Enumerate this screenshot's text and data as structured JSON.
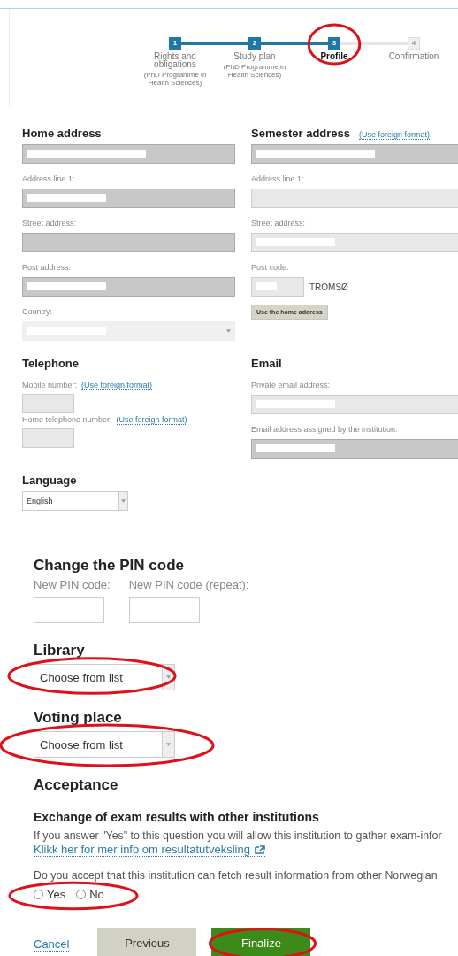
{
  "steps": [
    {
      "number": "1",
      "label": "Rights and obligations",
      "sublabel": "(PhD Programme in Health Sciences)",
      "done": true,
      "current": false
    },
    {
      "number": "2",
      "label": "Study plan",
      "sublabel": "(PhD Programme in Health Sciences)",
      "done": true,
      "current": false
    },
    {
      "number": "3",
      "label": "Profile",
      "done": true,
      "current": true,
      "highlighted": true
    },
    {
      "number": "4",
      "label": "Confirmation",
      "done": false,
      "current": false
    }
  ],
  "home_address": {
    "title": "Home address",
    "fields": [
      {
        "kind": "text",
        "disabled": true,
        "redacted": true
      },
      {
        "kind": "text",
        "label": "Address line 1:",
        "disabled": true,
        "redacted": true
      },
      {
        "kind": "text",
        "label": "Street address:",
        "disabled": true,
        "redacted": false
      },
      {
        "kind": "text",
        "label": "Post address:",
        "disabled": true,
        "redacted": true
      },
      {
        "kind": "select",
        "label": "Country:",
        "disabled": true,
        "redacted": true
      }
    ]
  },
  "semester_address": {
    "title": "Semester address",
    "link": "(Use foreign format)",
    "fields": [
      {
        "kind": "text",
        "disabled": true,
        "redacted": true
      },
      {
        "kind": "text",
        "label": "Address line 1:",
        "disabled": false
      },
      {
        "kind": "text",
        "label": "Street address:",
        "disabled": false,
        "redacted": true
      },
      {
        "kind": "postcode",
        "label": "Post code:",
        "disabled": false,
        "redacted": true,
        "place": "TROMSØ"
      }
    ],
    "button": "Use the home address"
  },
  "telephone": {
    "title": "Telephone",
    "fields": [
      {
        "label": "Mobile number:",
        "link": "(Use foreign format)"
      },
      {
        "label": "Home telephone number:",
        "link": "(Use foreign format)"
      }
    ]
  },
  "email": {
    "title": "Email",
    "fields": [
      {
        "label": "Private email address:",
        "disabled": false,
        "redacted": true
      },
      {
        "label": "Email address assigned by the institution:",
        "disabled": true,
        "redacted": true
      }
    ]
  },
  "language": {
    "title": "Language",
    "value": "English"
  },
  "pin": {
    "title": "Change the PIN code",
    "fields": [
      {
        "label": "New PIN code:"
      },
      {
        "label": "New PIN code (repeat):"
      }
    ]
  },
  "library": {
    "title": "Library",
    "value": "Choose from list",
    "highlighted": true
  },
  "voting_place": {
    "title": "Voting place",
    "value": "Choose from list",
    "highlighted": true
  },
  "acceptance": {
    "title": "Acceptance",
    "subtitle": "Exchange of exam results with other institutions",
    "text": "If you answer \"Yes\" to this question you will allow this institution to gather exam-infor",
    "link": "Klikk her for mer info om resultatutveksling",
    "question": "Do you accept that this institution can fetch result information from other Norwegian",
    "options": [
      {
        "label": "Yes",
        "selected": false
      },
      {
        "label": "No",
        "selected": false
      }
    ],
    "highlighted": true
  },
  "buttons": [
    {
      "kind": "link",
      "label": "Cancel"
    },
    {
      "kind": "secondary",
      "label": "Previous"
    },
    {
      "kind": "primary",
      "label": "Finalize",
      "highlighted": true
    }
  ]
}
